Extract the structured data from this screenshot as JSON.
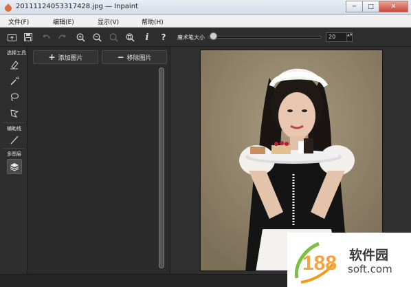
{
  "window": {
    "title": "20111124053317428.jpg — Inpaint",
    "minimize": "─",
    "maximize": "□",
    "close": "✕"
  },
  "menu": [
    "文件(F)",
    "编辑(E)",
    "显示(V)",
    "帮助(H)"
  ],
  "toolbar": {
    "icons": [
      "open-icon",
      "save-icon",
      "undo-icon",
      "redo-icon",
      "zoom-in-icon",
      "zoom-out-icon",
      "actual-size-icon",
      "fit-icon",
      "info-icon",
      "help-icon"
    ],
    "marker_label": "魔术笔大小",
    "marker_value": "20",
    "marker_level": 0.05,
    "spin_arrows": "▲▼"
  },
  "tools": {
    "selection_label": "选择工具",
    "guide_label": "辅助线",
    "multilayer_label": "多图层",
    "icons": [
      "marker-icon",
      "magic-wand-icon",
      "lasso-icon",
      "polygonal-lasso-icon",
      "guide-line-icon",
      "layers-icon"
    ]
  },
  "panel": {
    "add_label": "添加图片",
    "remove_label": "移除图片",
    "plus": "+",
    "minus": "−"
  },
  "watermark": {
    "name": "软件园",
    "domain": "soft.com",
    "logo_text": "188"
  }
}
